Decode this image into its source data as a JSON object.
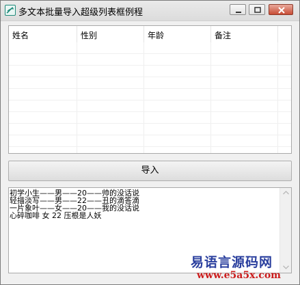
{
  "window": {
    "title": "多文本批量导入超级列表框例程",
    "icon": "app-icon",
    "controls": [
      "minimize-icon",
      "maximize-icon",
      "close-icon"
    ]
  },
  "listview": {
    "columns": [
      "姓名",
      "性别",
      "年龄",
      "备注"
    ],
    "rows": []
  },
  "import_button": {
    "label": "导入"
  },
  "textbox": {
    "lines": [
      "初学小生——男——20——帅的没话说",
      "轻描淡写——男——22——丑的滴答滴",
      "一片象叶——女——20——我的没话说",
      "心碎咖啡 女 22 压根是人妖"
    ]
  },
  "watermark": {
    "name": "易语言源码网",
    "url": "www.e5a5x.com"
  },
  "colors": {
    "watermark_name": "#2a3f9e",
    "watermark_url": "#cc1c1c",
    "window_bg": "#f0f0f0"
  }
}
